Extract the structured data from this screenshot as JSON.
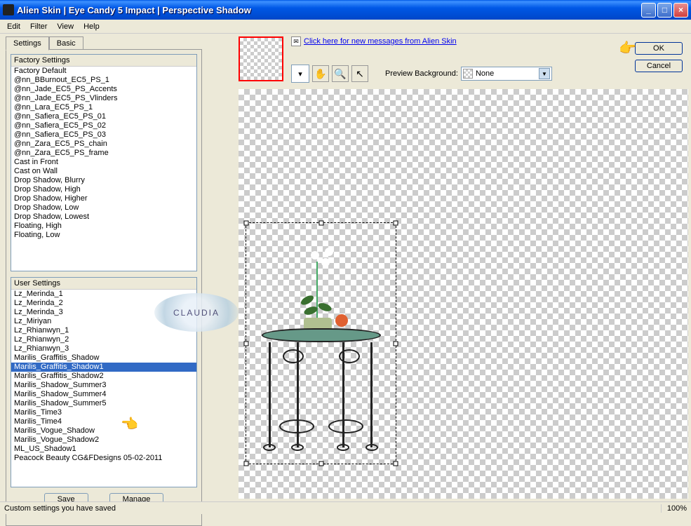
{
  "window": {
    "title": "Alien Skin  |  Eye Candy 5 Impact  |  Perspective Shadow"
  },
  "menubar": {
    "edit": "Edit",
    "filter": "Filter",
    "view": "View",
    "help": "Help"
  },
  "tabs": {
    "settings": "Settings",
    "basic": "Basic"
  },
  "factory": {
    "header": "Factory Settings",
    "items": [
      "Factory Default",
      "@nn_BBurnout_EC5_PS_1",
      "@nn_Jade_EC5_PS_Accents",
      "@nn_Jade_EC5_PS_Vlinders",
      "@nn_Lara_EC5_PS_1",
      "@nn_Safiera_EC5_PS_01",
      "@nn_Safiera_EC5_PS_02",
      "@nn_Safiera_EC5_PS_03",
      "@nn_Zara_EC5_PS_chain",
      "@nn_Zara_EC5_PS_frame",
      "Cast in Front",
      "Cast on Wall",
      "Drop Shadow, Blurry",
      "Drop Shadow, High",
      "Drop Shadow, Higher",
      "Drop Shadow, Low",
      "Drop Shadow, Lowest",
      "Floating, High",
      "Floating, Low"
    ]
  },
  "user": {
    "header": "User Settings",
    "items": [
      {
        "label": "Lz_Merinda_1",
        "sel": false
      },
      {
        "label": "Lz_Merinda_2",
        "sel": false
      },
      {
        "label": "Lz_Merinda_3",
        "sel": false
      },
      {
        "label": "Lz_Miriyan",
        "sel": false
      },
      {
        "label": "Lz_Rhianwyn_1",
        "sel": false
      },
      {
        "label": "Lz_Rhianwyn_2",
        "sel": false
      },
      {
        "label": "Lz_Rhianwyn_3",
        "sel": false
      },
      {
        "label": "Marilis_Graffitis_Shadow",
        "sel": false
      },
      {
        "label": "Marilis_Graffitis_Shadow1",
        "sel": true
      },
      {
        "label": "Marilis_Graffitis_Shadow2",
        "sel": false
      },
      {
        "label": "Marilis_Shadow_Summer3",
        "sel": false
      },
      {
        "label": "Marilis_Shadow_Summer4",
        "sel": false
      },
      {
        "label": "Marilis_Shadow_Summer5",
        "sel": false
      },
      {
        "label": "Marilis_Time3",
        "sel": false
      },
      {
        "label": "Marilis_Time4",
        "sel": false
      },
      {
        "label": "Marilis_Vogue_Shadow",
        "sel": false
      },
      {
        "label": "Marilis_Vogue_Shadow2",
        "sel": false
      },
      {
        "label": "ML_US_Shadow1",
        "sel": false
      },
      {
        "label": "Peacock Beauty CG&FDesigns 05-02-2011",
        "sel": false
      }
    ]
  },
  "buttons": {
    "save": "Save",
    "manage": "Manage",
    "ok": "OK",
    "cancel": "Cancel"
  },
  "message": {
    "link": "Click here for new messages from Alien Skin"
  },
  "preview": {
    "bg_label": "Preview Background:",
    "bg_value": "None"
  },
  "status": {
    "text": "Custom settings you have saved",
    "zoom": "100%"
  },
  "watermark": "CLAUDIA"
}
